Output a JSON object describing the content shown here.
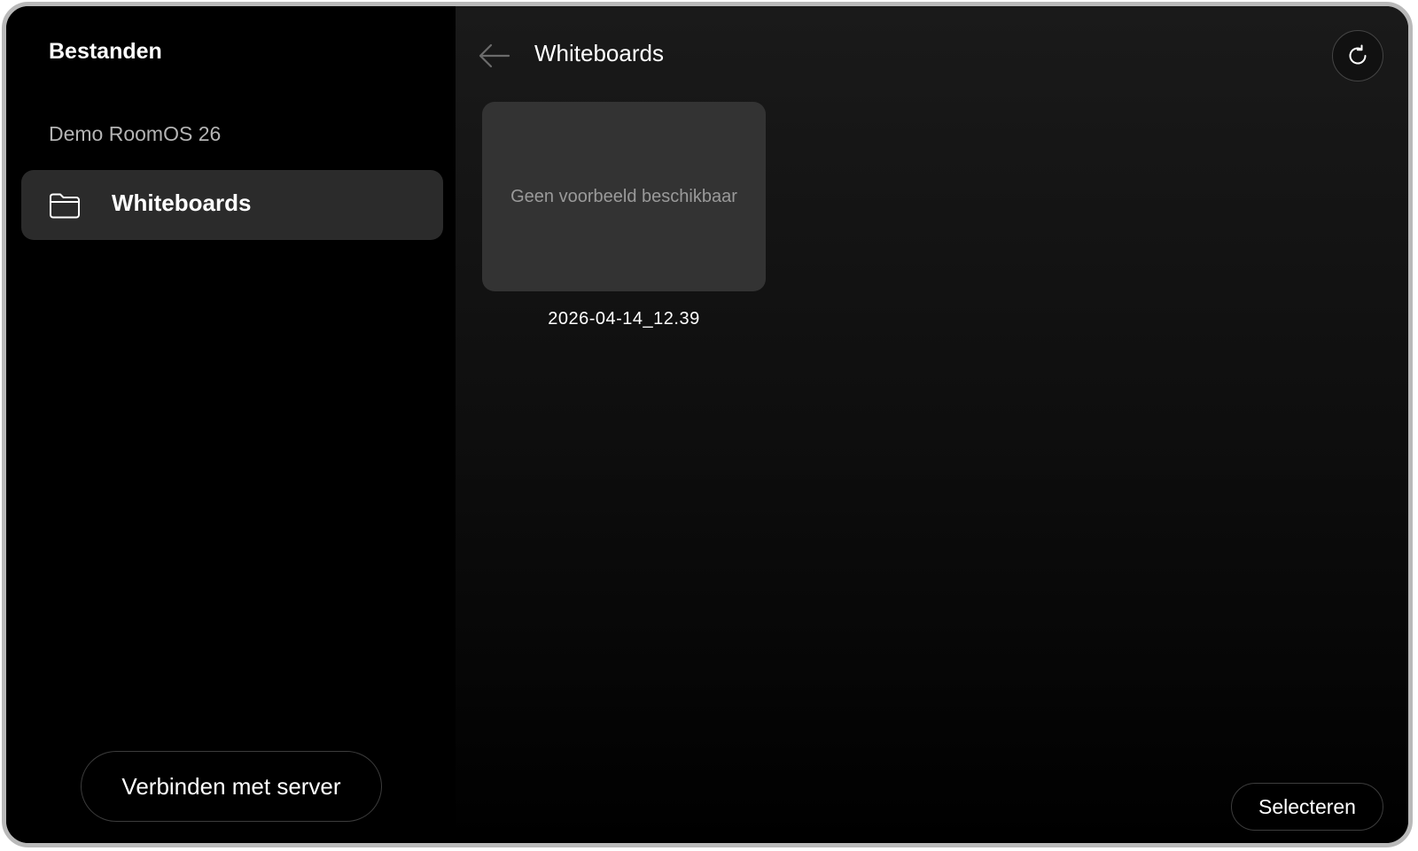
{
  "sidebar": {
    "title": "Bestanden",
    "device_name": "Demo RoomOS 26",
    "items": [
      {
        "label": "Whiteboards",
        "icon": "folder-icon",
        "selected": true
      }
    ],
    "connect_button_label": "Verbinden met server"
  },
  "main": {
    "title": "Whiteboards",
    "back_icon": "arrow-left-icon",
    "refresh_icon": "refresh-icon",
    "files": [
      {
        "thumbnail_text": "Geen voorbeeld beschikbaar",
        "name": "2026-04-14_12.39"
      }
    ],
    "select_button_label": "Selecteren"
  },
  "colors": {
    "background": "#000000",
    "selected_item": "#2b2b2b",
    "thumbnail": "#333333",
    "muted_text": "#b4b4b4"
  }
}
